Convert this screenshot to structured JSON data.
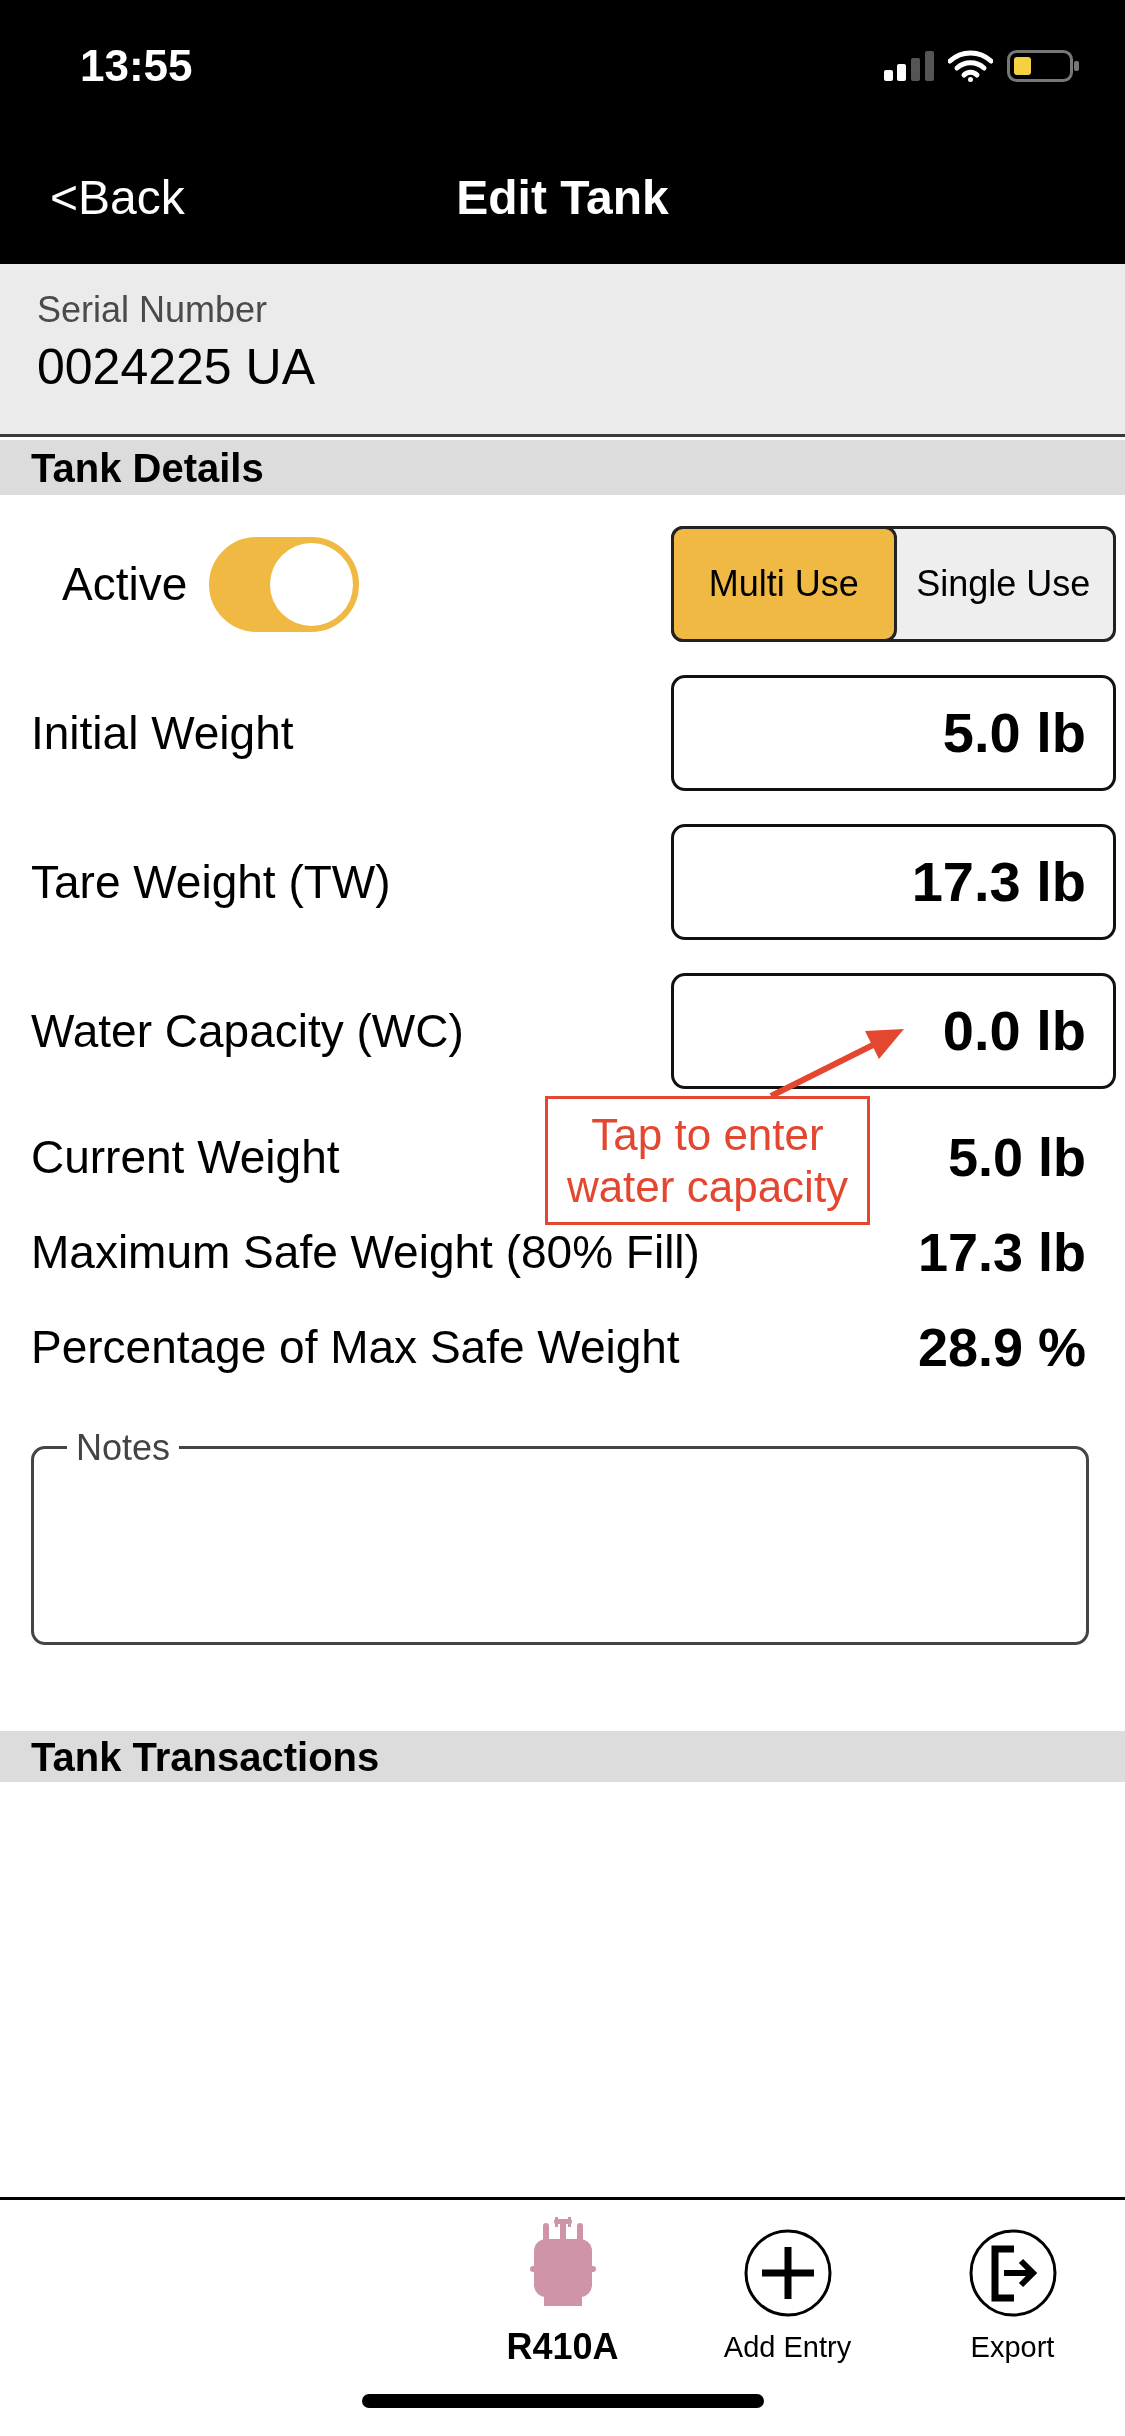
{
  "status_bar": {
    "time": "13:55"
  },
  "nav_bar": {
    "back": "<Back",
    "title": "Edit Tank"
  },
  "serial_number": {
    "label": "Serial Number",
    "value": "0024225 UA"
  },
  "tank_details": {
    "heading": "Tank Details",
    "active": {
      "label": "Active",
      "on": true
    },
    "use_type": [
      {
        "label": "Multi Use",
        "selected": true
      },
      {
        "label": "Single Use",
        "selected": false
      }
    ],
    "fields": [
      {
        "label": "Initial Weight",
        "value": "5.0 lb"
      },
      {
        "label": "Tare Weight (TW)",
        "value": "17.3 lb"
      },
      {
        "label": "Water Capacity (WC)",
        "value": "0.0 lb"
      }
    ],
    "callout": "Tap to enter water capacity",
    "readings": [
      {
        "label": "Current Weight",
        "value": "5.0 lb"
      },
      {
        "label": "Maximum Safe Weight (80% Fill)",
        "value": "17.3 lb"
      },
      {
        "label": "Percentage of Max Safe Weight",
        "value": "28.9 %"
      }
    ],
    "notes": {
      "label": "Notes"
    }
  },
  "tank_transactions": {
    "heading": "Tank Transactions"
  },
  "toolbar": [
    {
      "kind": "tank",
      "label": "R410A"
    },
    {
      "kind": "add",
      "label": "Add Entry"
    },
    {
      "kind": "export",
      "label": "Export"
    }
  ]
}
